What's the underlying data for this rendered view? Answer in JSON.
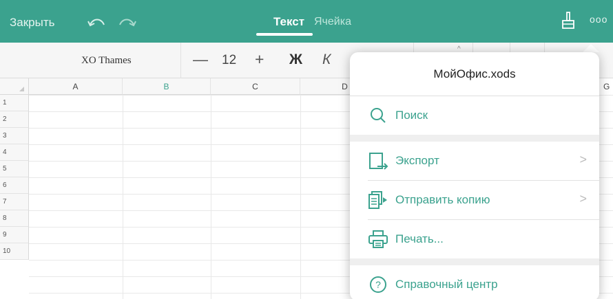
{
  "toolbar": {
    "close_label": "Закрыть",
    "tab_text": "Текст",
    "tab_cell": "Ячейка",
    "more_glyph": "ooo"
  },
  "format": {
    "font_name": "XO Thames",
    "minus_glyph": "—",
    "size": "12",
    "plus_glyph": "+",
    "bold_glyph": "Ж",
    "italic_glyph": "К"
  },
  "grid": {
    "columns": [
      "A",
      "B",
      "C",
      "D",
      "G"
    ],
    "selected_column": "B",
    "rows": [
      "1",
      "2",
      "3",
      "4",
      "5",
      "6",
      "7",
      "8",
      "9",
      "10"
    ]
  },
  "menu": {
    "title": "МойОфис.xods",
    "items": [
      {
        "label": "Поиск",
        "icon": "search-icon"
      },
      {
        "label": "Экспорт",
        "icon": "export-icon",
        "has_submenu": true
      },
      {
        "label": "Отправить копию",
        "icon": "send-copy-icon",
        "has_submenu": true
      },
      {
        "label": "Печать...",
        "icon": "printer-icon"
      },
      {
        "label": "Справочный центр",
        "icon": "help-icon"
      }
    ],
    "chevron_glyph": ">"
  },
  "colors": {
    "accent": "#3ba28e",
    "toolbar_bg": "#3ba28e"
  }
}
